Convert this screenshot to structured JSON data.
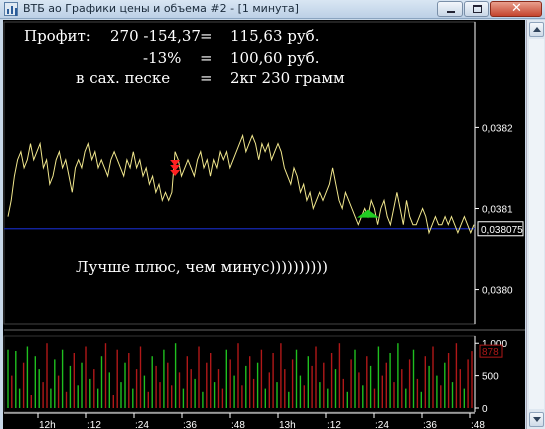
{
  "window": {
    "title": "ВТБ ао Графики цены и объема #2 - [1 минута]",
    "icon": "chart-window-icon"
  },
  "overlay_notes": {
    "line1_label": "Профит:",
    "line1_expr": "270 -154,37",
    "line1_eq": "=",
    "line1_result": "115,63 руб.",
    "line2_pct": "-13%",
    "line2_eq": "=",
    "line2_result": "100,60 руб.",
    "line3_label": "в сах. песке",
    "line3_eq": "=",
    "line3_result": "2кг 230 грамм",
    "comment": "Лучше плюс, чем минус))))))))))"
  },
  "colors": {
    "background": "#000000",
    "price_line": "#f0e68c",
    "current_line": "#1428b4",
    "axis": "#ffffff",
    "volume_up": "#1fbf1f",
    "volume_down": "#b01818",
    "sell_marker": "#ff2020",
    "buy_marker": "#22cc22"
  },
  "chart_data": [
    {
      "type": "line",
      "title": "",
      "y_ticks": [
        "0,0382",
        "0,0381",
        "0,0380"
      ],
      "y_tick_values": [
        0.0382,
        0.0381,
        0.038
      ],
      "ylim": [
        0.03796,
        0.03833
      ],
      "current_price_label": "0,038075",
      "current_price": 0.038075,
      "markers": [
        {
          "kind": "sell",
          "index": 52,
          "price": 0.03815
        },
        {
          "kind": "buy",
          "index": 112,
          "price": 0.03809
        }
      ],
      "values": [
        0.03809,
        0.03811,
        0.03814,
        0.03816,
        0.03817,
        0.03815,
        0.03816,
        0.03818,
        0.03816,
        0.03817,
        0.03818,
        0.03815,
        0.03816,
        0.03813,
        0.03814,
        0.03816,
        0.03817,
        0.03815,
        0.03816,
        0.03814,
        0.03812,
        0.03815,
        0.03816,
        0.03815,
        0.03817,
        0.03818,
        0.03816,
        0.03817,
        0.03815,
        0.03816,
        0.03815,
        0.03814,
        0.03816,
        0.03817,
        0.03816,
        0.03815,
        0.03814,
        0.03816,
        0.03815,
        0.03817,
        0.03815,
        0.03816,
        0.03814,
        0.03815,
        0.03813,
        0.03814,
        0.03812,
        0.03813,
        0.03811,
        0.03812,
        0.03811,
        0.03812,
        0.03817,
        0.03816,
        0.03814,
        0.03815,
        0.03816,
        0.03815,
        0.03814,
        0.03816,
        0.03817,
        0.03815,
        0.03816,
        0.03814,
        0.03816,
        0.03815,
        0.03817,
        0.03816,
        0.03817,
        0.03815,
        0.03816,
        0.03817,
        0.03818,
        0.03819,
        0.03817,
        0.03818,
        0.03819,
        0.03818,
        0.03816,
        0.03818,
        0.03817,
        0.03818,
        0.03816,
        0.03817,
        0.03818,
        0.03817,
        0.03815,
        0.03814,
        0.03813,
        0.03815,
        0.03814,
        0.03812,
        0.03813,
        0.03811,
        0.03812,
        0.0381,
        0.03811,
        0.03812,
        0.03811,
        0.03812,
        0.03813,
        0.03815,
        0.03813,
        0.03811,
        0.0381,
        0.03812,
        0.03811,
        0.0381,
        0.03809,
        0.03808,
        0.03809,
        0.0381,
        0.03809,
        0.03811,
        0.0381,
        0.03808,
        0.0381,
        0.03811,
        0.03809,
        0.03808,
        0.0381,
        0.03812,
        0.0381,
        0.03808,
        0.03811,
        0.03809,
        0.03808,
        0.03808,
        0.03809,
        0.0381,
        0.03809,
        0.03807,
        0.03808,
        0.03809,
        0.03808,
        0.03808,
        0.03809,
        0.03808,
        0.03809,
        0.03808,
        0.03807,
        0.03808,
        0.03809,
        0.03808,
        0.03807,
        0.03808
      ]
    },
    {
      "type": "bar",
      "title": "",
      "y_ticks": [
        "1 000",
        "500",
        "0"
      ],
      "y_tick_values": [
        1000,
        500,
        0
      ],
      "ylim": [
        0,
        1050
      ],
      "current_volume_label": "878",
      "x_tick_labels": [
        "12h",
        ":12",
        ":24",
        ":36",
        ":48",
        "13h",
        ":12",
        ":24",
        ":36",
        ":48"
      ],
      "values": [
        900,
        500,
        880,
        300,
        700,
        950,
        200,
        800,
        600,
        400,
        1000,
        300,
        750,
        500,
        900,
        250,
        650,
        850,
        350,
        700,
        950,
        450,
        600,
        300,
        800,
        1000,
        550,
        200,
        900,
        400,
        700,
        850,
        300,
        600,
        950,
        500,
        250,
        800,
        650,
        400,
        900,
        700,
        350,
        1000,
        550,
        300,
        800,
        600,
        450,
        950,
        250,
        700,
        850,
        400,
        600,
        300,
        900,
        750,
        500,
        1000,
        350,
        650,
        800,
        450,
        700,
        900,
        300,
        550,
        850,
        400,
        1000,
        600,
        250,
        750,
        900,
        500,
        350,
        800,
        650,
        950,
        400,
        700,
        300,
        850,
        600,
        1000,
        450,
        250,
        750,
        900,
        550,
        350,
        800,
        650,
        300,
        950,
        500,
        700,
        850,
        400,
        1000,
        600,
        300,
        750,
        900,
        450,
        250,
        800,
        650,
        950,
        500,
        350,
        700,
        850,
        400,
        1000,
        600,
        300,
        750,
        878
      ],
      "up": [
        1,
        0,
        1,
        1,
        0,
        1,
        0,
        1,
        1,
        0,
        0,
        1,
        1,
        0,
        1,
        0,
        1,
        0,
        1,
        1,
        0,
        1,
        0,
        1,
        1,
        0,
        1,
        0,
        0,
        1,
        1,
        0,
        1,
        0,
        0,
        1,
        0,
        1,
        0,
        0,
        1,
        0,
        0,
        1,
        0,
        1,
        0,
        0,
        1,
        0,
        1,
        0,
        0,
        1,
        0,
        0,
        1,
        0,
        1,
        0,
        0,
        1,
        0,
        0,
        1,
        0,
        1,
        0,
        0,
        1,
        0,
        0,
        1,
        0,
        1,
        1,
        0,
        1,
        0,
        0,
        1,
        0,
        1,
        0,
        1,
        0,
        0,
        1,
        0,
        1,
        0,
        1,
        0,
        1,
        0,
        1,
        0,
        0,
        1,
        0,
        1,
        0,
        1,
        0,
        1,
        0,
        1,
        0,
        1,
        0,
        1,
        0,
        1,
        0,
        1,
        0,
        0,
        1,
        0,
        0
      ]
    }
  ]
}
